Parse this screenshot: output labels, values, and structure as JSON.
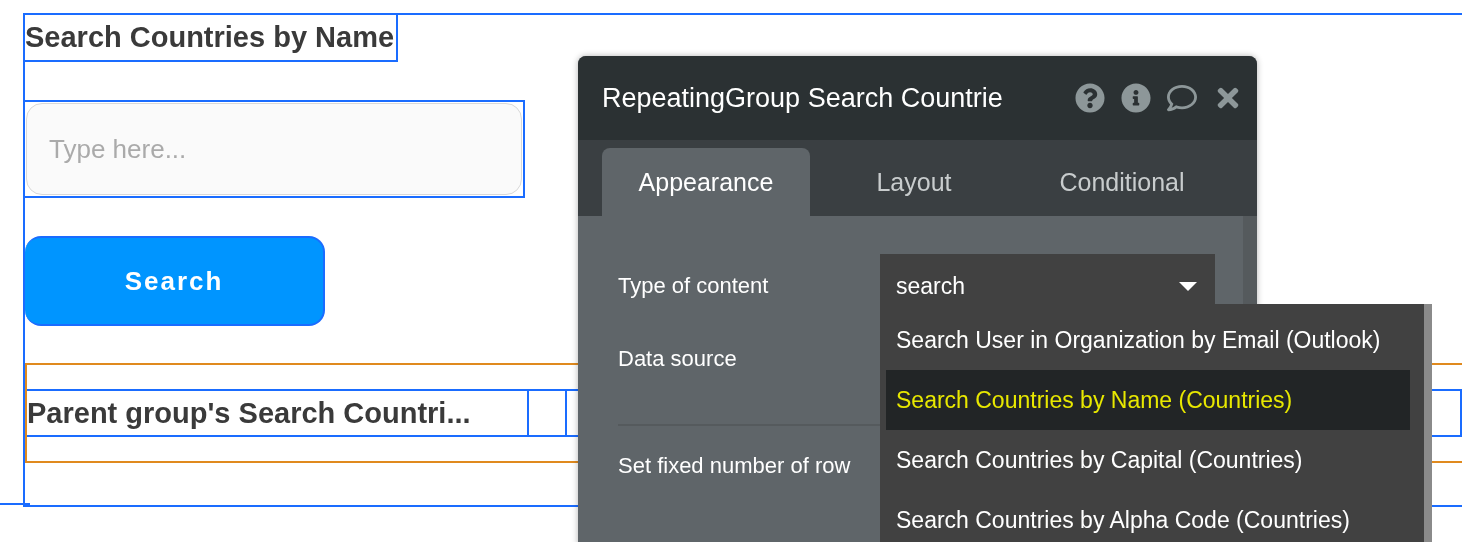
{
  "canvas": {
    "heading": "Search Countries by Name",
    "search_input": {
      "placeholder": "Type here..."
    },
    "search_button": {
      "label": "Search"
    },
    "repeating_group": {
      "cells": [
        "Parent group's Search Countri..."
      ]
    }
  },
  "panel": {
    "title": "RepeatingGroup Search Countrie",
    "tabs": [
      {
        "label": "Appearance",
        "selected": true
      },
      {
        "label": "Layout",
        "selected": false
      },
      {
        "label": "Conditional",
        "selected": false
      }
    ],
    "fields": [
      {
        "label": "Type of content",
        "value": "search"
      },
      {
        "label": "Data source"
      },
      {
        "label": "Set fixed number of row"
      }
    ],
    "dropdown_options": [
      {
        "label": "Search User in Organization by Email (Outlook)",
        "selected": false
      },
      {
        "label": "Search Countries by Name (Countries)",
        "selected": true
      },
      {
        "label": "Search Countries by Capital (Countries)",
        "selected": false
      },
      {
        "label": "Search Countries by Alpha Code (Countries)",
        "selected": false
      }
    ]
  }
}
